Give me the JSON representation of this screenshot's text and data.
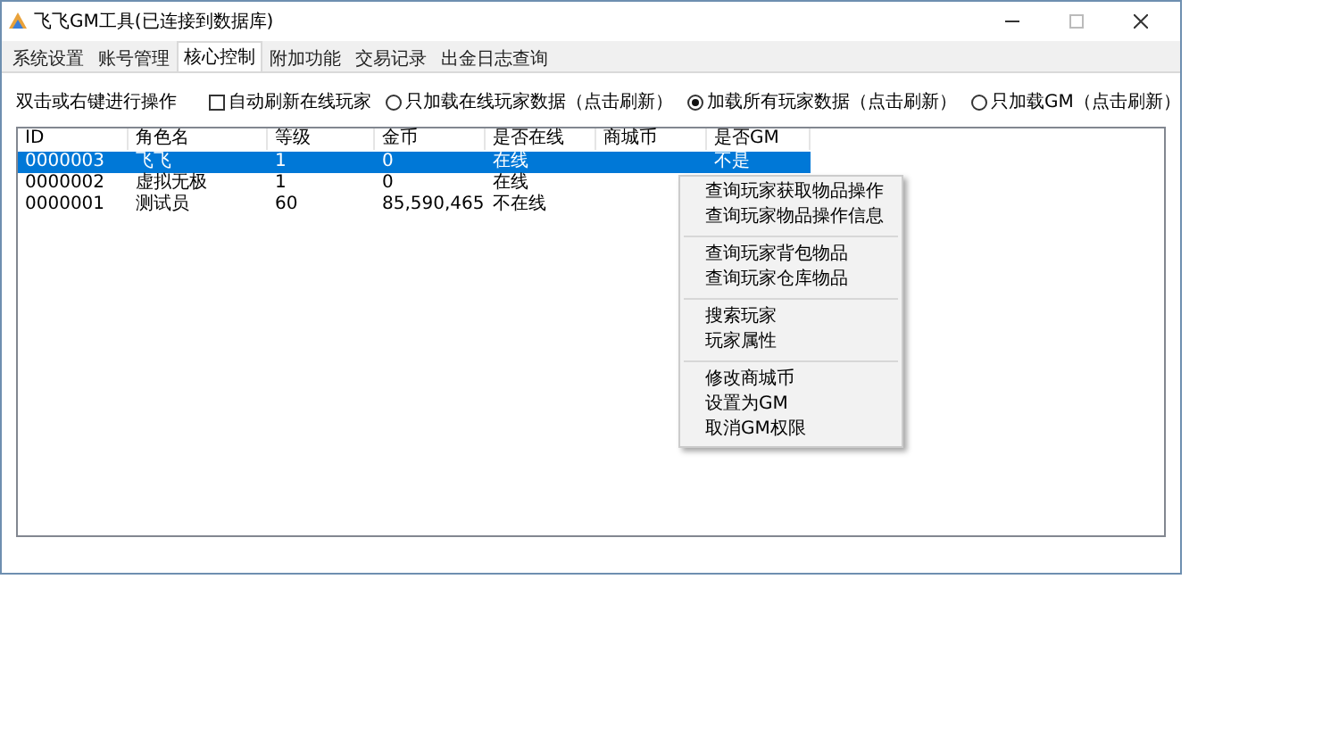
{
  "window": {
    "title": "飞飞GM工具(已连接到数据库)"
  },
  "tabs": [
    {
      "label": "系统设置",
      "selected": false
    },
    {
      "label": "账号管理",
      "selected": false
    },
    {
      "label": "核心控制",
      "selected": true
    },
    {
      "label": "附加功能",
      "selected": false
    },
    {
      "label": "交易记录",
      "selected": false
    },
    {
      "label": "出金日志查询",
      "selected": false
    }
  ],
  "hint": "双击或右键进行操作",
  "options": [
    {
      "kind": "checkbox",
      "label": "自动刷新在线玩家",
      "checked": false
    },
    {
      "kind": "radio",
      "label": "只加载在线玩家数据（点击刷新）",
      "selected": false
    },
    {
      "kind": "radio",
      "label": "加载所有玩家数据（点击刷新）",
      "selected": true
    },
    {
      "kind": "radio",
      "label": "只加载GM（点击刷新）",
      "selected": false
    }
  ],
  "table": {
    "columns": [
      "ID",
      "角色名",
      "等级",
      "金币",
      "是否在线",
      "商城币",
      "是否GM"
    ],
    "rows": [
      {
        "cells": [
          "0000003",
          "飞飞",
          "1",
          "0",
          "在线",
          "",
          "不是"
        ],
        "selected": true
      },
      {
        "cells": [
          "0000002",
          "虚拟无极",
          "1",
          "0",
          "在线",
          "",
          ""
        ],
        "selected": false
      },
      {
        "cells": [
          "0000001",
          "测试员",
          "60",
          "85,590,465",
          "不在线",
          "",
          ""
        ],
        "selected": false
      }
    ]
  },
  "context_menu": {
    "groups": [
      [
        "查询玩家获取物品操作",
        "查询玩家物品操作信息"
      ],
      [
        "查询玩家背包物品",
        "查询玩家仓库物品"
      ],
      [
        "搜索玩家",
        "玩家属性"
      ],
      [
        "修改商城币",
        "设置为GM",
        "取消GM权限"
      ]
    ]
  }
}
